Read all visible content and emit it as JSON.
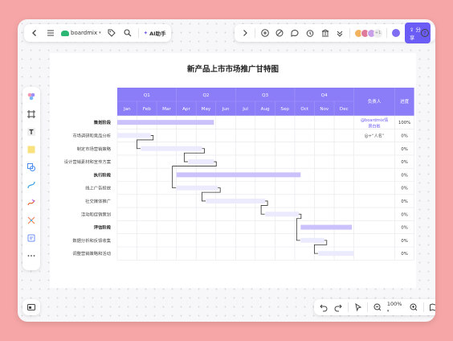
{
  "toolbar": {
    "brand": "boardmix",
    "ai_label": "AI助手",
    "share_label": "分享",
    "avatar_extra": "+1",
    "zoom": "100%"
  },
  "chart": {
    "title": "新产品上市市场推广甘特图",
    "quarters": [
      "Q1",
      "Q2",
      "Q3",
      "Q4"
    ],
    "months": [
      "Jan",
      "Feb",
      "Mar",
      "Apr",
      "May",
      "Jun",
      "Jul",
      "Aug",
      "Sep",
      "Oct",
      "Nov",
      "Dec"
    ],
    "owner_header": "负责人",
    "progress_header": "进度",
    "colors": {
      "header": "#8b7cf7",
      "header_border": "#a598fa",
      "phase_bar": "#cbc2fb",
      "task_bar": "#ecebfd",
      "task_bar_alt": "#f0effd"
    },
    "rows": [
      {
        "label": "策划阶段",
        "phase": true,
        "start": 0,
        "end": 4.9,
        "owner": "@boardmix情景白板",
        "progress": "100%"
      },
      {
        "label": "市场调研和竞品分析",
        "phase": false,
        "start": 0,
        "end": 1.7,
        "owner": "@+“人名”",
        "progress": "0%"
      },
      {
        "label": "制定市场营销策略",
        "phase": false,
        "start": 1.2,
        "end": 4.3,
        "owner": "",
        "progress": "0%"
      },
      {
        "label": "设计营销素材和宣传方案",
        "phase": false,
        "start": 3.6,
        "end": 4.9,
        "owner": "",
        "progress": "0%"
      },
      {
        "label": "执行阶段",
        "phase": true,
        "start": 3.0,
        "end": 9.3,
        "owner": "",
        "progress": "0%"
      },
      {
        "label": "线上广告投放",
        "phase": false,
        "start": 3.0,
        "end": 5.1,
        "owner": "",
        "progress": "0%"
      },
      {
        "label": "社交媒体推广",
        "phase": false,
        "start": 4.5,
        "end": 7.5,
        "owner": "",
        "progress": "0%"
      },
      {
        "label": "活动和促销策划",
        "phase": false,
        "start": 7.5,
        "end": 9.2,
        "owner": "",
        "progress": "0%"
      },
      {
        "label": "评估阶段",
        "phase": true,
        "start": 9.3,
        "end": 11.9,
        "owner": "",
        "progress": "0%"
      },
      {
        "label": "数据分析和反馈收集",
        "phase": false,
        "start": 9.3,
        "end": 10.5,
        "owner": "",
        "progress": "0%"
      },
      {
        "label": "调整营销策略和活动",
        "phase": false,
        "start": 10.2,
        "end": 12,
        "owner": "",
        "progress": "0%"
      }
    ],
    "links": [
      [
        1,
        2
      ],
      [
        2,
        3
      ],
      [
        3,
        5
      ],
      [
        5,
        6
      ],
      [
        6,
        7
      ],
      [
        7,
        9
      ],
      [
        9,
        10
      ]
    ]
  }
}
